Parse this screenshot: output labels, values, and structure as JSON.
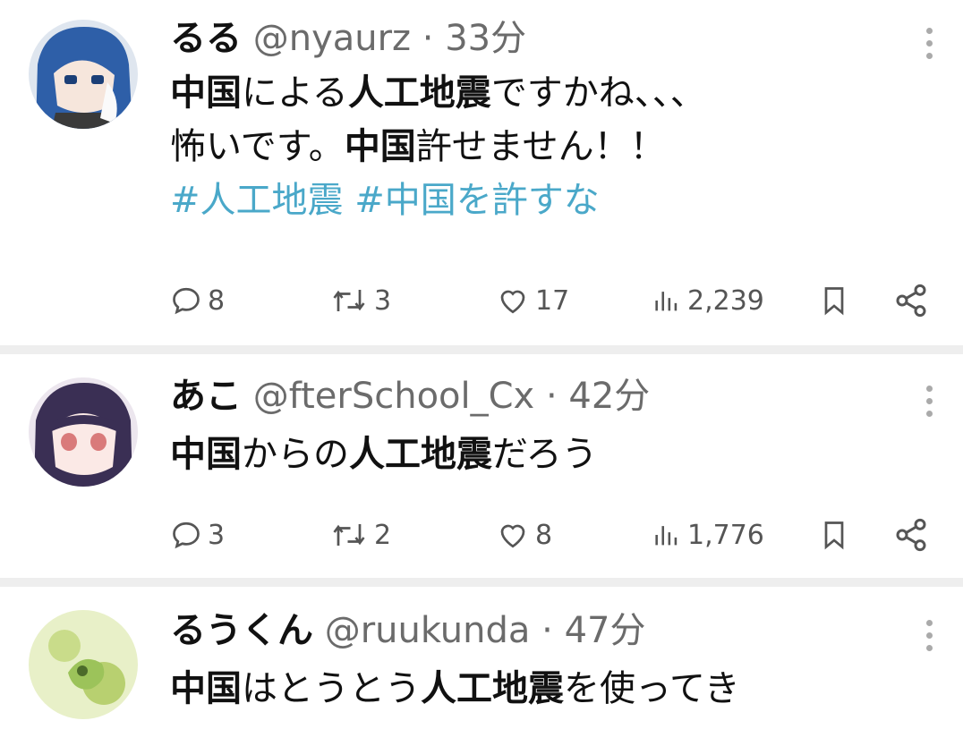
{
  "posts": [
    {
      "name": "るる",
      "handle": "@nyaurz",
      "dot": "·",
      "time": "33分",
      "line1": [
        {
          "t": "中国",
          "b": true
        },
        {
          "t": "による",
          "b": false
        },
        {
          "t": "人工地震",
          "b": true
        },
        {
          "t": "ですかね、、、",
          "b": false
        }
      ],
      "line2": [
        {
          "t": "怖いです。",
          "b": false
        },
        {
          "t": "中国",
          "b": true
        },
        {
          "t": "許せません！！",
          "b": false
        }
      ],
      "hashtags": "#人工地震 #中国を許すな",
      "replies": "8",
      "reposts": "3",
      "likes": "17",
      "views": "2,239"
    },
    {
      "name": "あこ",
      "handle": "@fterSchool_Cx",
      "dot": "·",
      "time": "42分",
      "line1": [
        {
          "t": "中国",
          "b": true
        },
        {
          "t": "からの",
          "b": false
        },
        {
          "t": "人工地震",
          "b": true
        },
        {
          "t": "だろう",
          "b": false
        }
      ],
      "replies": "3",
      "reposts": "2",
      "likes": "8",
      "views": "1,776"
    },
    {
      "name": "るうくん",
      "handle": "@ruukunda",
      "dot": "·",
      "time": "47分",
      "line1": [
        {
          "t": "中国",
          "b": true
        },
        {
          "t": "はとうとう",
          "b": false
        },
        {
          "t": "人工地震",
          "b": true
        },
        {
          "t": "を使ってき",
          "b": false
        }
      ]
    }
  ],
  "icons": {
    "more": "more-vertical-icon",
    "reply": "reply-bubble-icon",
    "repost": "repost-arrows-icon",
    "like": "heart-icon",
    "views": "bar-chart-icon",
    "bookmark": "bookmark-icon",
    "share": "share-nodes-icon"
  },
  "colors": {
    "hashtag": "#4aa8c9",
    "meta": "#6b6b6b",
    "divider": "#eeeeee"
  }
}
